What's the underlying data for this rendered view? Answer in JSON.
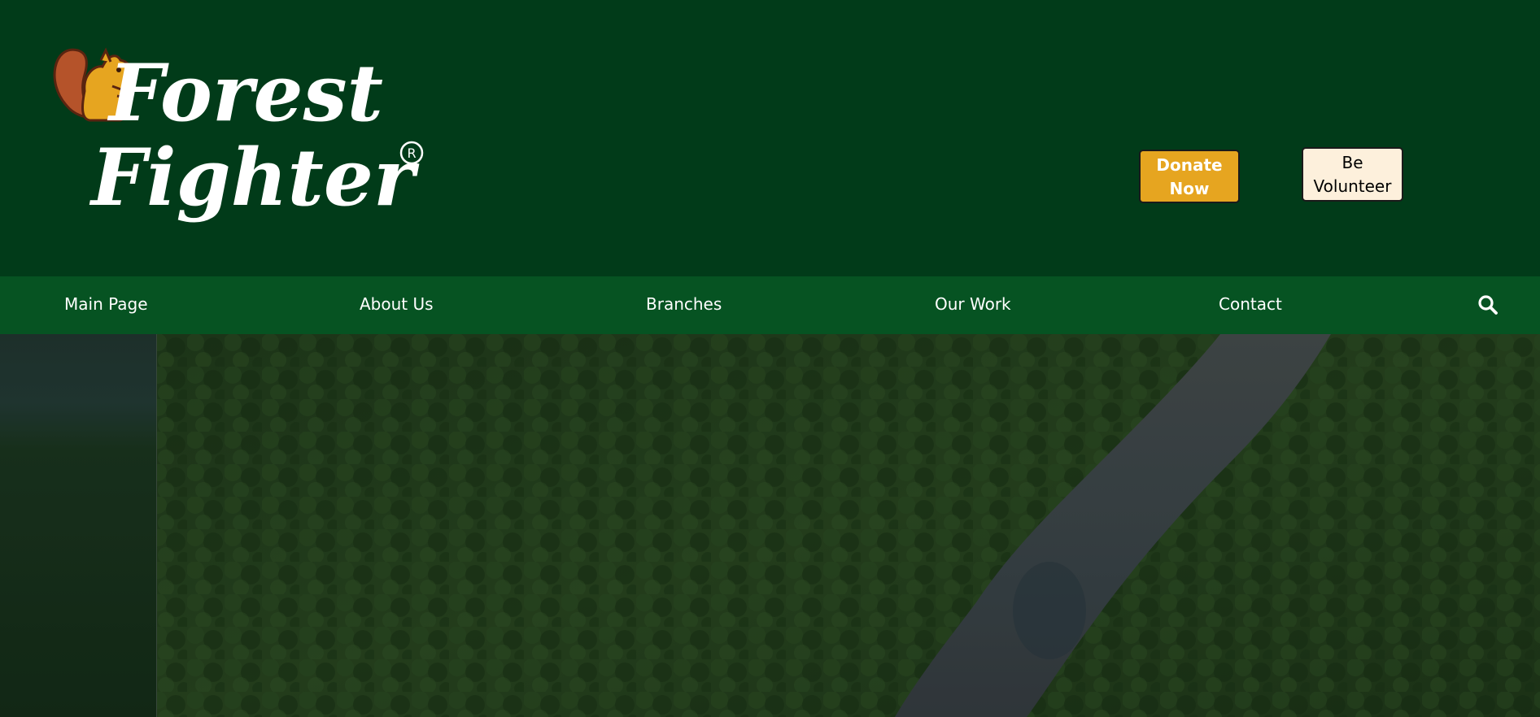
{
  "brand": {
    "line1": "Forest",
    "line2": "Fighter",
    "registered_mark": "R",
    "mascot_icon": "squirrel-icon"
  },
  "header": {
    "donate_label": "Donate Now",
    "volunteer_label": "Be Volunteer"
  },
  "nav": {
    "items": [
      {
        "label": "Main Page"
      },
      {
        "label": "About Us"
      },
      {
        "label": "Branches"
      },
      {
        "label": "Our Work"
      },
      {
        "label": "Contact"
      }
    ],
    "search_icon": "search-icon"
  },
  "colors": {
    "header_bg": "#013b19",
    "nav_bg": "#065322",
    "donate_bg": "#e6a520",
    "volunteer_bg": "#fdf0dc",
    "text_light": "#ffffff"
  },
  "hero": {
    "image": "aerial-forest-river-image"
  }
}
